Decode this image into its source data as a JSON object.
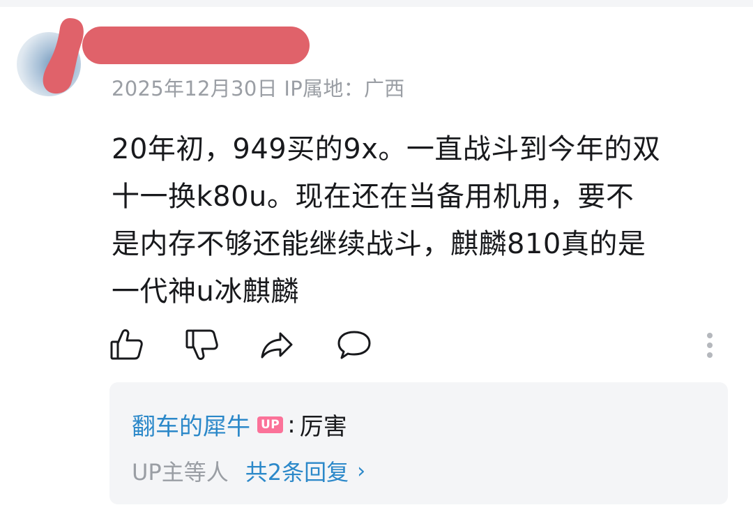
{
  "comment": {
    "meta": "2025年12月30日 IP属地：广西",
    "lines": [
      "20年初，949买的9x。一直战斗到今年的双",
      "十一换k80u。现在还在当备用机用，要不",
      "是内存不够还能继续战斗，麒麟810真的是",
      "一代神u冰麒麟"
    ]
  },
  "actions": {
    "icons": [
      "thumbs-up-icon",
      "thumbs-down-icon",
      "share-icon",
      "comment-icon",
      "more-vertical-icon"
    ]
  },
  "reply": {
    "author": "翻车的犀牛",
    "badge": "UP",
    "colon": ":",
    "text": "厉害",
    "summary_who": "UP主等人",
    "summary_link": "共2条回复",
    "chevron": "›"
  },
  "colors": {
    "link_blue": "#2b88c9",
    "up_badge_pink": "#fb7299",
    "meta_gray": "#9a9ea4",
    "redaction_red": "#e0626a"
  }
}
